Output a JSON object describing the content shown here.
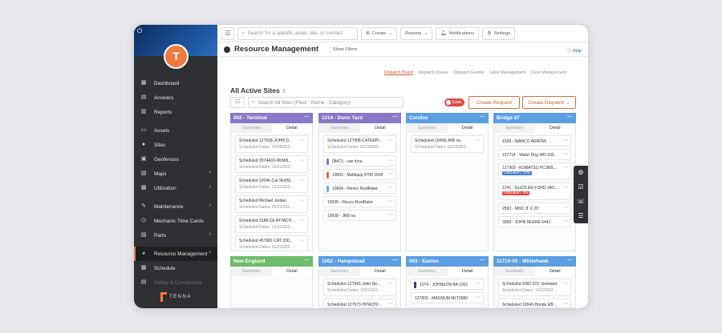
{
  "sidebar": {
    "avatar_initial": "T",
    "items": [
      {
        "label": "Dashboard",
        "icon": "dashboard-icon",
        "glyph": "▦"
      },
      {
        "label": "Answers",
        "icon": "answers-icon",
        "glyph": "▤"
      },
      {
        "label": "Reports",
        "icon": "reports-icon",
        "glyph": "▥"
      },
      {
        "label": "Assets",
        "icon": "assets-icon",
        "glyph": "▭"
      },
      {
        "label": "Sites",
        "icon": "sites-icon",
        "glyph": "●"
      },
      {
        "label": "Geofences",
        "icon": "geofences-icon",
        "glyph": "▣"
      },
      {
        "label": "Maps",
        "icon": "maps-icon",
        "glyph": "▧"
      },
      {
        "label": "Utilization",
        "icon": "utilization-icon",
        "glyph": "▩"
      },
      {
        "label": "Maintenance",
        "icon": "maintenance-icon",
        "glyph": "✎"
      },
      {
        "label": "Mechanic Time Cards",
        "icon": "time-cards-icon",
        "glyph": "◷"
      },
      {
        "label": "Parts",
        "icon": "parts-icon",
        "glyph": "▨"
      },
      {
        "label": "Resource Management",
        "icon": "resource-management-icon",
        "glyph": "◕"
      },
      {
        "label": "Schedule",
        "icon": "schedule-icon",
        "glyph": "▦"
      },
      {
        "label": "Safety & Compliance",
        "icon": "safety-icon",
        "glyph": "▤"
      }
    ],
    "logo_text": "TENNA"
  },
  "topbar": {
    "search_placeholder": "Search for a specific asset, site, or contact",
    "create_label": "Create",
    "reports_label": "Reports",
    "notifications_label": "Notifications",
    "settings_label": "Settings"
  },
  "header": {
    "title": "Resource Management",
    "show_filters": "Show Filters",
    "help": "Help"
  },
  "tabs": [
    "Dispatch Board",
    "Dispatch Queue",
    "Dispatch Events",
    "Labor Management",
    "Crew Management"
  ],
  "sites_title": "All Active Sites",
  "site_search_placeholder": "Search All Sites (Fleet - Name - Category)",
  "live_label": "Live",
  "create_request_label": "Create Request",
  "create_dispatch_label": "Create Dispatch",
  "col_tab_summary": "Summary",
  "col_tab_detail": "Detail",
  "columns": [
    {
      "title": "002 - Terminal",
      "color": "#8a77c7",
      "cards": [
        {
          "l1": "Scheduled 127608-JOHN D...",
          "l2": "Scheduled Dates: 01/09/202..."
        },
        {
          "l1": "Scheduled 2074A16-McMill...",
          "l2": "Scheduled Dates: 01/21/202..."
        },
        {
          "l1": "Scheduled 10046-Cat SkidSt...",
          "l2": "Scheduled Dates: 01/21/202..."
        },
        {
          "l1": "Scheduled Michael Jordan",
          "l2": "Scheduled Dates: 01/21/202..."
        },
        {
          "l1": "Scheduled 3188-CE ATTACH...",
          "l2": "Scheduled Dates: 01/21/202..."
        },
        {
          "l1": "Scheduled 457982-CAT 330...",
          "l2": "Scheduled Dates: 01/21/202..."
        }
      ]
    },
    {
      "title": "1214 - Dunn Yard",
      "color": "#8a77c7",
      "cards": [
        {
          "l1": "Scheduled 127908-CATERPI...",
          "l2": "Scheduled Dates: 02/19/202..."
        },
        {
          "l1": "08473 - can funu",
          "stripe": "#8a77c7"
        },
        {
          "l1": "10003 - Multiquip 9700 2005",
          "stripe": "#e06a3a"
        },
        {
          "l1": "10004 - Flexco RootRake",
          "stripe": "#6aaed6"
        },
        {
          "l1": "10005 - Flexco RootRake"
        },
        {
          "l1": "10008 - JRB na"
        }
      ]
    },
    {
      "title": "Condos",
      "color": "#5a9ee3",
      "cards": [
        {
          "l1": "Scheduled 10008-JRB na",
          "l2": "Scheduled Dates: 02/16/202..."
        }
      ]
    },
    {
      "title": "Bridge 87",
      "color": "#5a9ee3",
      "cards": [
        {
          "l1": "1028 - WANCO ARROW"
        },
        {
          "l1": "127714 - Water Dog WD-100..."
        },
        {
          "l1": "127903 - KOMATSU PC360L...",
          "util": "Utilization: 73%",
          "util_color": "#3d7fd6"
        },
        {
          "l1": "1741 - GUZZLER FORD VAC...",
          "util": "Utilization: 4%",
          "util_color": "#e5483e"
        },
        {
          "l1": "2593 - MISC 8' X 20'"
        },
        {
          "l1": "3099 - JOHN DEERE 644J"
        }
      ]
    },
    {
      "title": "New England",
      "color": "#6dbb6b",
      "cards": []
    },
    {
      "title": "1002 - Hampstead",
      "color": "#5a9ee3",
      "cards": [
        {
          "l1": "Scheduled 127641-John De...",
          "l2": "Scheduled Dates: 10/01/202..."
        },
        {
          "l1": "Scheduled 127673-HITACHI ..."
        }
      ]
    },
    {
      "title": "003 - Easton",
      "color": "#5a9ee3",
      "cards": [
        {
          "l1": "1074 - JOHNSON BA 1001",
          "stripe": "#2f3a6e"
        },
        {
          "l1": "127603 - MAGNUM MLT3060"
        }
      ]
    },
    {
      "title": "11710-00 - Whitehawk",
      "color": "#5a9ee3",
      "cards": [
        {
          "l1": "Scheduled SW2-223 -Sweeper",
          "l2": "Scheduled Dates: 10/22/202..."
        },
        {
          "l1": "Scheduled 10043-Honda EB..."
        }
      ]
    }
  ]
}
